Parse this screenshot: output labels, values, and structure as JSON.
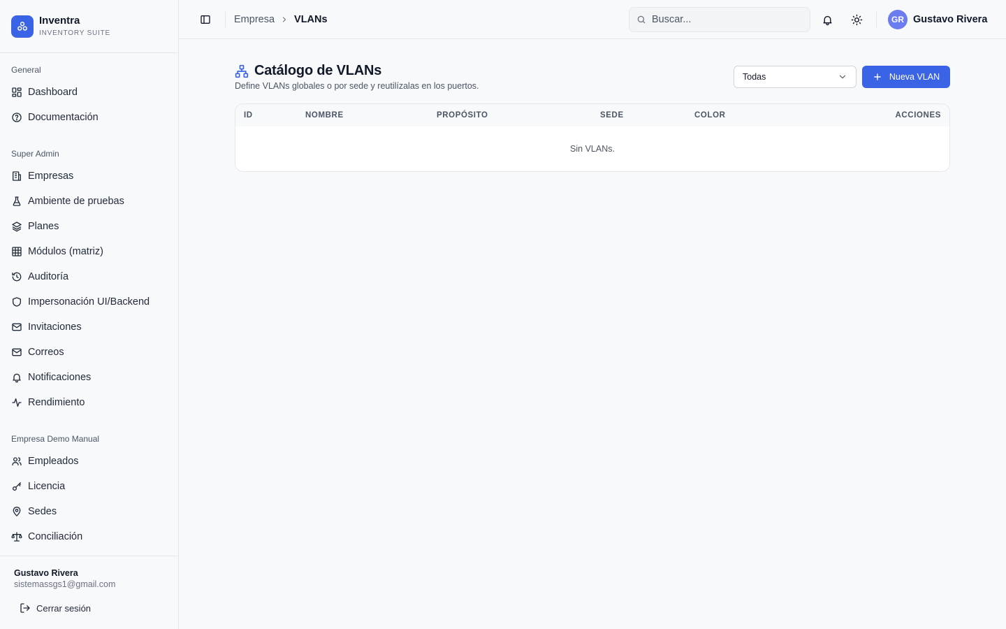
{
  "brand": {
    "name": "Inventra",
    "tagline": "INVENTORY SUITE"
  },
  "sidebar": {
    "sections": [
      {
        "label": "General",
        "items": [
          {
            "label": "Dashboard",
            "icon": "dashboard-icon"
          },
          {
            "label": "Documentación",
            "icon": "help-circle-icon"
          }
        ]
      },
      {
        "label": "Super Admin",
        "items": [
          {
            "label": "Empresas",
            "icon": "building-icon"
          },
          {
            "label": "Ambiente de pruebas",
            "icon": "flask-icon"
          },
          {
            "label": "Planes",
            "icon": "layers-icon"
          },
          {
            "label": "Módulos (matriz)",
            "icon": "grid-icon"
          },
          {
            "label": "Auditoría",
            "icon": "history-icon"
          },
          {
            "label": "Impersonación UI/Backend",
            "icon": "shield-icon"
          },
          {
            "label": "Invitaciones",
            "icon": "mail-icon"
          },
          {
            "label": "Correos",
            "icon": "mail-icon"
          },
          {
            "label": "Notificaciones",
            "icon": "bell-icon"
          },
          {
            "label": "Rendimiento",
            "icon": "activity-icon"
          }
        ]
      },
      {
        "label": "Empresa Demo Manual",
        "items": [
          {
            "label": "Empleados",
            "icon": "users-icon"
          },
          {
            "label": "Licencia",
            "icon": "key-icon"
          },
          {
            "label": "Sedes",
            "icon": "map-pin-icon"
          },
          {
            "label": "Conciliación",
            "icon": "scale-icon"
          }
        ]
      }
    ],
    "footer": {
      "user_name": "Gustavo Rivera",
      "user_email": "sistemassgs1@gmail.com",
      "logout_label": "Cerrar sesión"
    }
  },
  "topbar": {
    "breadcrumb": {
      "parent": "Empresa",
      "current": "VLANs"
    },
    "search_placeholder": "Buscar...",
    "user": {
      "initials": "GR",
      "name": "Gustavo Rivera"
    }
  },
  "page": {
    "title": "Catálogo de VLANs",
    "subtitle": "Define VLANs globales o por sede y reutilízalas en los puertos.",
    "filter_value": "Todas",
    "new_button_label": "Nueva VLAN",
    "table": {
      "columns": [
        "ID",
        "Nombre",
        "Propósito",
        "Sede",
        "Color",
        "Acciones"
      ],
      "empty_message": "Sin VLANs."
    }
  },
  "colors": {
    "accent": "#3b63e6",
    "avatar": "#6b7bf0",
    "border": "#e5e7eb",
    "background": "#f8f9fb"
  }
}
